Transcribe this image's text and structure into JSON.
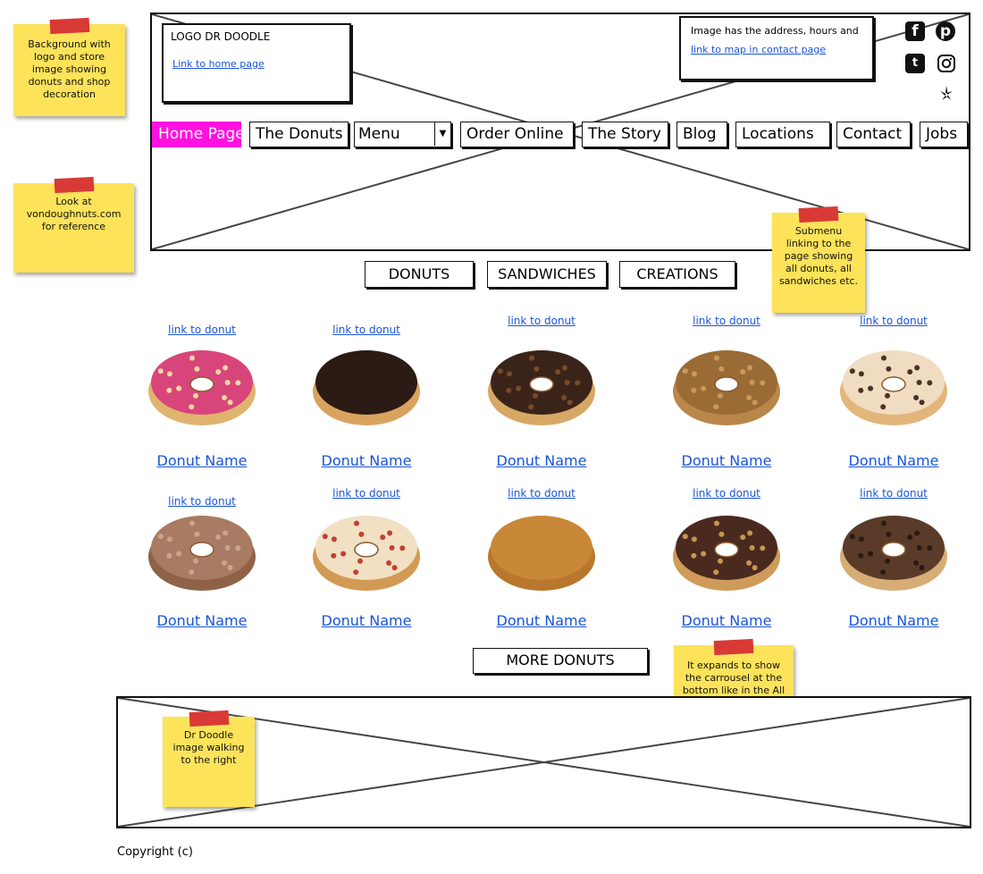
{
  "notes": {
    "background": "Background with logo and store image showing donuts and shop decoration",
    "reference": "Look at vondoughnuts.com for reference",
    "submenu": "Submenu linking to the page showing all donuts, all sandwiches etc.",
    "expands": "It expands to show the carrousel at the bottom like in the All donuts page",
    "doodle": "Dr Doodle image walking to the right"
  },
  "header": {
    "logo_text": "LOGO DR DOODLE",
    "home_link": "Link to home page",
    "contact_text": "Image has the address, hours and",
    "contact_link": "link to map in contact page"
  },
  "social_icons": [
    "facebook-icon",
    "pinterest-icon",
    "twitter-icon",
    "instagram-icon",
    "yelp-icon"
  ],
  "nav": {
    "home": "Home Page",
    "donuts": "The Donuts",
    "menu_select": "Menu",
    "order": "Order Online",
    "story": "The Story",
    "blog": "Blog",
    "locations": "Locations",
    "contact": "Contact",
    "jobs": "Jobs"
  },
  "submenu": [
    "DONUTS",
    "SANDWICHES",
    "CREATIONS"
  ],
  "donuts": [
    {
      "link": "link to donut",
      "name": "Donut Name",
      "style": "pink-glaze"
    },
    {
      "link": "link to donut",
      "name": "Donut Name",
      "style": "chocolate-filled"
    },
    {
      "link": "link to donut",
      "name": "Donut Name",
      "style": "chocolate-crumble"
    },
    {
      "link": "link to donut",
      "name": "Donut Name",
      "style": "cinnamon-crumble"
    },
    {
      "link": "link to donut",
      "name": "Donut Name",
      "style": "cream-drizzle"
    },
    {
      "link": "link to donut",
      "name": "Donut Name",
      "style": "sugar-ring"
    },
    {
      "link": "link to donut",
      "name": "Donut Name",
      "style": "candy-sprinkle"
    },
    {
      "link": "link to donut",
      "name": "Donut Name",
      "style": "plain-filled"
    },
    {
      "link": "link to donut",
      "name": "Donut Name",
      "style": "chocolate-peanut"
    },
    {
      "link": "link to donut",
      "name": "Donut Name",
      "style": "chocolate-drizzle"
    }
  ],
  "more_button": "MORE DONUTS",
  "footer": {
    "copyright": "Copyright (c)"
  },
  "colors": {
    "active_nav": "#ff11e0",
    "link": "#1a55d9",
    "sticky": "#fce35a",
    "tape": "#d93a36"
  }
}
